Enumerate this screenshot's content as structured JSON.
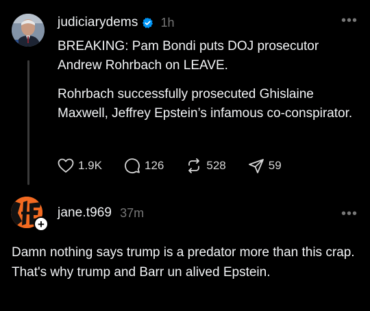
{
  "post": {
    "username": "judiciarydems",
    "verified": true,
    "time": "1h",
    "paragraph1": "BREAKING: Pam Bondi puts DOJ prosecutor Andrew Rohrbach on LEAVE.",
    "paragraph2": "Rohrbach successfully prosecuted Ghislaine Maxwell, Jeffrey Epstein’s infamous co-conspirator.",
    "actions": {
      "likes": "1.9K",
      "comments": "126",
      "reposts": "528",
      "shares": "59"
    },
    "more_icon": "more-horizontal-icon"
  },
  "reply": {
    "username": "jane.t969",
    "time": "37m",
    "text": "Damn nothing says trump is a predator more than this crap. That's why trump and Barr un alived Epstein.",
    "plus_label": "+"
  },
  "colors": {
    "background": "#000000",
    "text": "#f3f5f7",
    "muted": "#777777",
    "verified": "#0095f6",
    "bengals_orange": "#f26a21"
  }
}
